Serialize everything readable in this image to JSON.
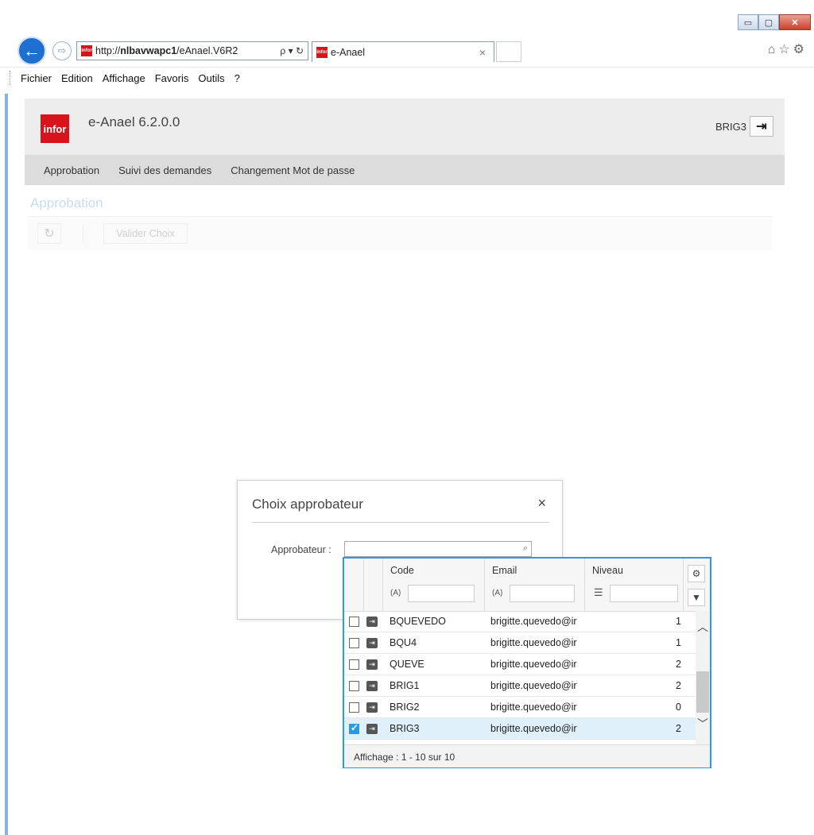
{
  "browser": {
    "url_prefix": "http://",
    "url_host": "nlbavwapc1",
    "url_path": "/eAnael.V6R2",
    "url_icons": "ρ ▾ ↻",
    "favicon_label": "infor",
    "tab_title": "e-Anael",
    "tab_close": "×",
    "menu": [
      "Fichier",
      "Edition",
      "Affichage",
      "Favoris",
      "Outils",
      "?"
    ],
    "window_controls": {
      "minimize": "▭",
      "maximize": "▢",
      "close": "✕"
    }
  },
  "app": {
    "logo_text": "infor",
    "title": "e-Anael 6.2.0.0",
    "user": "BRIG3",
    "nav": [
      "Approbation",
      "Suivi des demandes",
      "Changement Mot de passe"
    ]
  },
  "page": {
    "title": "Approbation",
    "toolbar": {
      "validate_label": "Valider Choix"
    }
  },
  "dialog": {
    "title": "Choix approbateur",
    "close": "×",
    "field_label": "Approbateur :",
    "field_value": ""
  },
  "lookup": {
    "columns": {
      "code": "Code",
      "email": "Email",
      "niveau": "Niveau"
    },
    "filter_ops": {
      "code": "(A)",
      "email": "(A)",
      "niveau": "☰"
    },
    "rows": [
      {
        "code": "BQUEVEDO",
        "email": "brigitte.quevedo@ir",
        "niveau": "1",
        "checked": false
      },
      {
        "code": "BQU4",
        "email": "brigitte.quevedo@ir",
        "niveau": "1",
        "checked": false
      },
      {
        "code": "QUEVE",
        "email": "brigitte.quevedo@ir",
        "niveau": "2",
        "checked": false
      },
      {
        "code": "BRIG1",
        "email": "brigitte.quevedo@ir",
        "niveau": "2",
        "checked": false
      },
      {
        "code": "BRIG2",
        "email": "brigitte.quevedo@ir",
        "niveau": "0",
        "checked": false
      },
      {
        "code": "BRIG3",
        "email": "brigitte.quevedo@ir",
        "niveau": "2",
        "checked": true
      }
    ],
    "footer": "Affichage : 1 - 10 sur 10",
    "selected_color": "#2b9ae0"
  },
  "colors": {
    "brand": "#d7131c",
    "accent": "#2b9ae0",
    "header_bg": "#ededed",
    "nav_bg": "#dcdcdc"
  }
}
